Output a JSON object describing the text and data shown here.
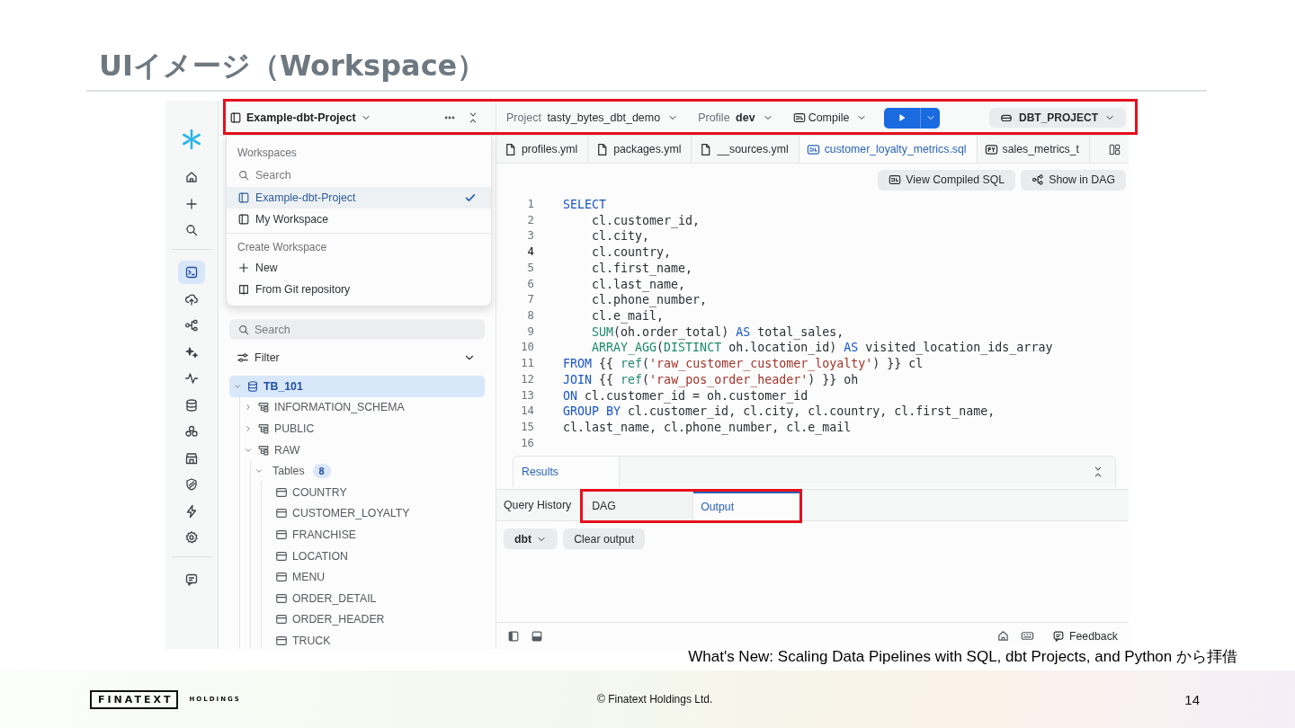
{
  "slide": {
    "title": "UIイメージ（Workspace）"
  },
  "app": {
    "rail": {
      "groups": [
        [
          {
            "selected": false
          },
          {
            "selected": false
          },
          {
            "selected": false
          }
        ],
        [
          {
            "selected": true
          },
          {
            "selected": false
          },
          {
            "selected": false
          },
          {
            "selected": false
          },
          {
            "selected": false
          },
          {
            "selected": false
          },
          {
            "selected": false
          },
          {
            "selected": false
          },
          {
            "selected": false
          },
          {
            "selected": false
          },
          {
            "selected": false
          }
        ],
        [
          {
            "selected": false
          }
        ]
      ]
    },
    "top_bar": {
      "highlighted": true,
      "workspace": "Example-dbt-Project",
      "project_label": "Project",
      "project": "tasty_bytes_dbt_demo",
      "profile_label": "Profile",
      "profile": "dev",
      "compile": "Compile",
      "database": "DBT_PROJECT"
    },
    "workspace_menu": {
      "sections": [
        {
          "heading": "Workspaces",
          "search_placeholder": "Search",
          "items": [
            {
              "label": "Example-dbt-Project",
              "kind": "workspace",
              "selected": true
            },
            {
              "label": "My Workspace",
              "kind": "workspace",
              "selected": false
            }
          ]
        },
        {
          "heading": "Create Workspace",
          "items": [
            {
              "label": "New",
              "kind": "new"
            },
            {
              "label": "From Git repository",
              "kind": "git"
            }
          ]
        }
      ]
    },
    "sidebar": {
      "search_placeholder": "Search",
      "filter": "Filter",
      "tree": [
        {
          "label": "TB_101",
          "kind": "database",
          "expanded": true,
          "selected": true,
          "children": [
            {
              "label": "INFORMATION_SCHEMA",
              "kind": "schema",
              "expanded": false,
              "selected": false
            },
            {
              "label": "PUBLIC",
              "kind": "schema",
              "expanded": false,
              "selected": false
            },
            {
              "label": "RAW",
              "kind": "schema",
              "expanded": true,
              "selected": false,
              "children": [
                {
                  "label": "Tables",
                  "expanded": true,
                  "selected": false,
                  "count": "8",
                  "children": [
                    {
                      "label": "COUNTRY",
                      "kind": "table",
                      "selected": false
                    },
                    {
                      "label": "CUSTOMER_LOYALTY",
                      "kind": "table",
                      "selected": false
                    },
                    {
                      "label": "FRANCHISE",
                      "kind": "table",
                      "selected": false
                    },
                    {
                      "label": "LOCATION",
                      "kind": "table",
                      "selected": false
                    },
                    {
                      "label": "MENU",
                      "kind": "table",
                      "selected": false
                    },
                    {
                      "label": "ORDER_DETAIL",
                      "kind": "table",
                      "selected": false
                    },
                    {
                      "label": "ORDER_HEADER",
                      "kind": "table",
                      "selected": false
                    },
                    {
                      "label": "TRUCK",
                      "kind": "table",
                      "selected": false
                    }
                  ]
                }
              ]
            }
          ]
        }
      ]
    },
    "editor": {
      "tabs": [
        {
          "label": "profiles.yml",
          "kind": "file",
          "selected": false
        },
        {
          "label": "packages.yml",
          "kind": "file",
          "selected": false
        },
        {
          "label": "__sources.yml",
          "kind": "file",
          "selected": false
        },
        {
          "label": "customer_loyalty_metrics.sql",
          "kind": "sql",
          "selected": true
        },
        {
          "label": "sales_metrics_t",
          "kind": "py",
          "selected": false
        }
      ],
      "actions": [
        {
          "label": "View Compiled SQL",
          "kind": "sql"
        },
        {
          "label": "Show in DAG",
          "kind": "dag"
        }
      ],
      "lines": [
        {
          "number": "1",
          "current": false,
          "tokens": [
            {
              "kind": "kw",
              "text": "SELECT"
            }
          ]
        },
        {
          "number": "2",
          "current": false,
          "tokens": [
            {
              "kind": "plain",
              "text": "    cl.customer_id,"
            }
          ]
        },
        {
          "number": "3",
          "current": false,
          "tokens": [
            {
              "kind": "plain",
              "text": "    cl.city,"
            }
          ]
        },
        {
          "number": "4",
          "current": true,
          "tokens": [
            {
              "kind": "plain",
              "text": "    cl.country,"
            }
          ]
        },
        {
          "number": "5",
          "current": false,
          "tokens": [
            {
              "kind": "plain",
              "text": "    cl.first_name,"
            }
          ]
        },
        {
          "number": "6",
          "current": false,
          "tokens": [
            {
              "kind": "plain",
              "text": "    cl.last_name,"
            }
          ]
        },
        {
          "number": "7",
          "current": false,
          "tokens": [
            {
              "kind": "plain",
              "text": "    cl.phone_number,"
            }
          ]
        },
        {
          "number": "8",
          "current": false,
          "tokens": [
            {
              "kind": "plain",
              "text": "    cl.e_mail,"
            }
          ]
        },
        {
          "number": "9",
          "current": false,
          "tokens": [
            {
              "kind": "fn",
              "text": "    SUM"
            },
            {
              "kind": "plain",
              "text": "(oh.order_total) "
            },
            {
              "kind": "kw",
              "text": "AS"
            },
            {
              "kind": "plain",
              "text": " total_sales,"
            }
          ]
        },
        {
          "number": "10",
          "current": false,
          "tokens": [
            {
              "kind": "fn",
              "text": "    ARRAY_AGG"
            },
            {
              "kind": "plain",
              "text": "("
            },
            {
              "kind": "fn",
              "text": "DISTINCT"
            },
            {
              "kind": "plain",
              "text": " oh.location_id) "
            },
            {
              "kind": "kw",
              "text": "AS"
            },
            {
              "kind": "plain",
              "text": " visited_location_ids_array"
            }
          ]
        },
        {
          "number": "11",
          "current": false,
          "tokens": [
            {
              "kind": "kw",
              "text": "FROM"
            },
            {
              "kind": "plain",
              "text": " {{ "
            },
            {
              "kind": "fn",
              "text": "ref"
            },
            {
              "kind": "plain",
              "text": "("
            },
            {
              "kind": "str",
              "text": "'raw_customer_customer_loyalty'"
            },
            {
              "kind": "plain",
              "text": ") }} cl"
            }
          ]
        },
        {
          "number": "12",
          "current": false,
          "tokens": [
            {
              "kind": "kw",
              "text": "JOIN"
            },
            {
              "kind": "plain",
              "text": " {{ "
            },
            {
              "kind": "fn",
              "text": "ref"
            },
            {
              "kind": "plain",
              "text": "("
            },
            {
              "kind": "str",
              "text": "'raw_pos_order_header'"
            },
            {
              "kind": "plain",
              "text": ") }} oh"
            }
          ]
        },
        {
          "number": "13",
          "current": false,
          "tokens": [
            {
              "kind": "kw",
              "text": "ON"
            },
            {
              "kind": "plain",
              "text": " cl.customer_id = oh.customer_id"
            }
          ]
        },
        {
          "number": "14",
          "current": false,
          "tokens": [
            {
              "kind": "kw",
              "text": "GROUP BY"
            },
            {
              "kind": "plain",
              "text": " cl.customer_id, cl.city, cl.country, cl.first_name,"
            }
          ]
        },
        {
          "number": "15",
          "current": false,
          "tokens": [
            {
              "kind": "plain",
              "text": "cl.last_name, cl.phone_number, cl.e_mail"
            }
          ]
        },
        {
          "number": "16",
          "current": false
        }
      ]
    },
    "results": {
      "title": "Results"
    },
    "output_panel": {
      "tab_groups": [
        {
          "highlighted": false,
          "tabs": [
            {
              "label": "Query History",
              "selected": false
            }
          ]
        },
        {
          "highlighted": true,
          "tabs": [
            {
              "label": "DAG",
              "selected": false
            },
            {
              "label": "Output",
              "selected": true
            }
          ]
        }
      ],
      "buttons": [
        {
          "label": "dbt",
          "kind": "menu"
        },
        {
          "label": "Clear output",
          "kind": "plain"
        }
      ]
    },
    "status_bar": {
      "feedback": "Feedback"
    }
  },
  "credit": "What's New: Scaling Data Pipelines with SQL, dbt Projects, and Python から拝借",
  "footer": {
    "logo": "FINATEXT",
    "logo_sub": "HOLDINGS",
    "copyright": "© Finatext Holdings Ltd.",
    "page": "14"
  }
}
